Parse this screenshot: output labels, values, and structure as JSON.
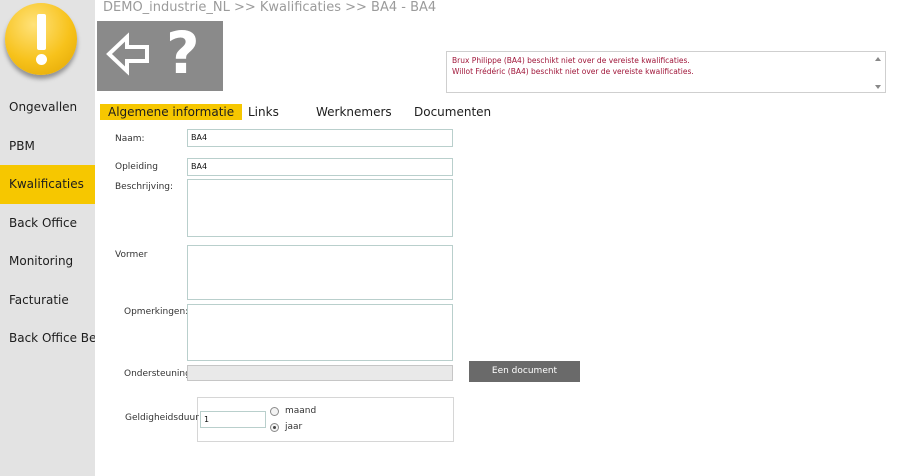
{
  "breadcrumb": "DEMO_industrie_NL  >>  Kwalificaties  >>  BA4 - BA4",
  "sidebar": {
    "items": [
      {
        "label": "Ongevallen",
        "active": false
      },
      {
        "label": "PBM",
        "active": false
      },
      {
        "label": "Kwalificaties",
        "active": true
      },
      {
        "label": "Back Office",
        "active": false
      },
      {
        "label": "Monitoring",
        "active": false
      },
      {
        "label": "Facturatie",
        "active": false
      },
      {
        "label": "Back Office Bedrijf",
        "active": false
      }
    ]
  },
  "toolbar": {
    "back_icon": "back-arrow-icon",
    "help_icon": "question-mark-icon",
    "help_glyph": "?"
  },
  "messages": [
    "Brux Philippe (BA4) beschikt niet over de vereiste kwalificaties.",
    "Willot Frédéric (BA4) beschikt niet over de vereiste kwalificaties."
  ],
  "tabs": [
    {
      "label": "Algemene informatie",
      "active": true
    },
    {
      "label": "Links",
      "active": false
    },
    {
      "label": "Werknemers",
      "active": false
    },
    {
      "label": "Documenten",
      "active": false
    }
  ],
  "form": {
    "naam_label": "Naam:",
    "naam_value": "BA4",
    "opleiding_label": "Opleiding",
    "opleiding_value": "BA4",
    "beschrijving_label": "Beschrijving:",
    "vormer_label": "Vormer",
    "opmerkingen_label": "Opmerkingen:",
    "ondersteuning_label": "Ondersteuning",
    "document_button": "Een document",
    "geldigheidsduur_label": "Geldigheidsduur",
    "geldigheidsduur_value": "1",
    "unit_options": [
      {
        "label": "maand",
        "checked": false
      },
      {
        "label": "jaar",
        "checked": true
      }
    ]
  },
  "colors": {
    "accent": "#f6c700",
    "sidebar_bg": "#e3e3e3",
    "toolbar_bg": "#8a8a8a",
    "message_text": "#a0173a",
    "button_bg": "#6a6a6a"
  }
}
